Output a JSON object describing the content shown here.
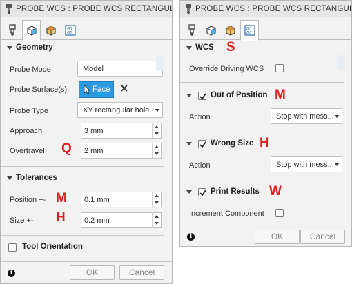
{
  "left_dialog": {
    "title": "PROBE WCS : PROBE WCS RECTANGULAR HO",
    "tabs": [
      {
        "icon": "tool-icon",
        "active": false
      },
      {
        "icon": "geometry-cube-icon",
        "active": true
      },
      {
        "icon": "heights-cube-icon",
        "active": false
      },
      {
        "icon": "g-code-icon",
        "active": false
      }
    ],
    "geometry": {
      "title": "Geometry",
      "probe_mode_label": "Probe Mode",
      "probe_mode_value": "Model",
      "probe_surfaces_label": "Probe Surface(s)",
      "face_button_label": "Face",
      "probe_type_label": "Probe Type",
      "probe_type_value": "XY rectangular hole",
      "approach_label": "Approach",
      "approach_value": "3 mm",
      "overtravel_label": "Overtravel",
      "overtravel_value": "2 mm"
    },
    "tolerances": {
      "title": "Tolerances",
      "position_label": "Position +-",
      "position_value": "0.1 mm",
      "size_label": "Size +-",
      "size_value": "0.2 mm"
    },
    "tool_orientation": {
      "title": "Tool Orientation",
      "checked": false
    },
    "footer": {
      "info": "i",
      "ok_label": "OK",
      "cancel_label": "Cancel"
    }
  },
  "right_dialog": {
    "title": "PROBE WCS : PROBE WCS RECTANGULAR HO",
    "tabs": [
      {
        "icon": "tool-icon",
        "active": false
      },
      {
        "icon": "geometry-cube-icon",
        "active": false
      },
      {
        "icon": "heights-cube-icon",
        "active": false
      },
      {
        "icon": "g-code-icon",
        "active": true
      }
    ],
    "wcs": {
      "title": "WCS",
      "override_label": "Override Driving WCS",
      "override_checked": false
    },
    "out_of_position": {
      "title": "Out of Position",
      "checked": true,
      "action_label": "Action",
      "action_value": "Stop with mess..."
    },
    "wrong_size": {
      "title": "Wrong Size",
      "checked": true,
      "action_label": "Action",
      "action_value": "Stop with mess..."
    },
    "print_results": {
      "title": "Print Results",
      "checked": true,
      "increment_label": "Increment Component",
      "increment_checked": false
    },
    "footer": {
      "info": "i",
      "ok_label": "OK",
      "cancel_label": "Cancel"
    }
  },
  "annotations": {
    "overtravel": "Q",
    "position": "M",
    "size": "H",
    "wcs": "S",
    "out_of_position": "M",
    "wrong_size": "H",
    "print_results": "W"
  },
  "colors": {
    "accent": "#2e9ae2",
    "annotation": "#e01e1e",
    "dialog_bg": "#f2f2f2"
  }
}
